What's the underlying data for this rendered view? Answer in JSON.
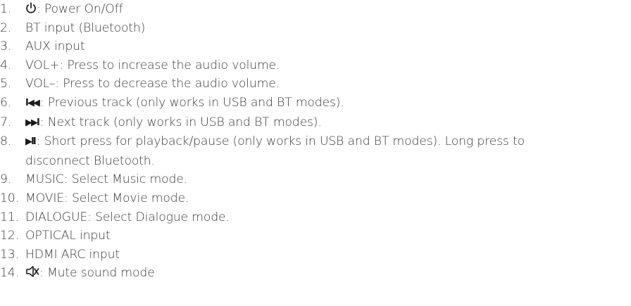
{
  "items": [
    {
      "number": "1.",
      "icon": "power-icon",
      "text": ": Power On/Off"
    },
    {
      "number": "2.",
      "text": "BT input (Bluetooth)"
    },
    {
      "number": "3.",
      "text": "AUX input"
    },
    {
      "number": "4.",
      "text": "VOL+: Press to increase the audio volume."
    },
    {
      "number": "5.",
      "text": "VOL–: Press to decrease the audio volume."
    },
    {
      "number": "6.",
      "icon": "previous-track-icon",
      "glyph": "I◀◀",
      "text": ": Previous track (only works in USB and BT modes)."
    },
    {
      "number": "7.",
      "icon": "next-track-icon",
      "glyph": "▶▶I",
      "text": ": Next track (only works in USB and BT modes)."
    },
    {
      "number": "8.",
      "icon": "play-pause-icon",
      "glyph": "▶II",
      "text": ": Short press for playback/pause (only works in USB and BT modes). Long press to",
      "text_cont": "disconnect Bluetooth."
    },
    {
      "number": "9.",
      "text": "MUSIC: Select Music mode."
    },
    {
      "number": "10.",
      "text": "MOVIE: Select Movie mode."
    },
    {
      "number": "11.",
      "text": "DIALOGUE: Select Dialogue mode."
    },
    {
      "number": "12.",
      "text": "OPTICAL input"
    },
    {
      "number": "13.",
      "text": "HDMI ARC input"
    },
    {
      "number": "14.",
      "icon": "mute-icon",
      "text": ": Mute sound mode"
    }
  ]
}
